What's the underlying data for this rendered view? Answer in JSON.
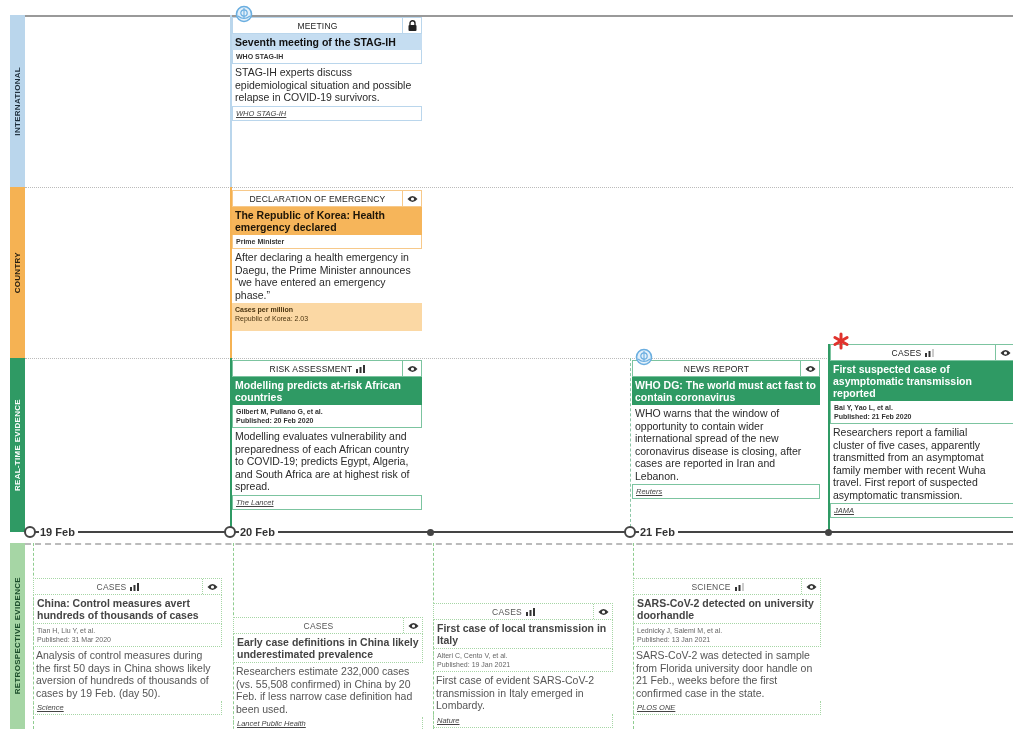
{
  "lanes": [
    {
      "kind": "international",
      "label": "INTERNATIONAL"
    },
    {
      "kind": "country",
      "label": "COUNTRY"
    },
    {
      "kind": "realtime",
      "label": "REAL-TIME EVIDENCE"
    },
    {
      "kind": "retrospective",
      "label": "RETROSPECTIVE EVIDENCE"
    }
  ],
  "columns": [
    {
      "kind": "open",
      "date": "19 Feb",
      "retrospective": [
        {
          "locked": false,
          "category": "CASES",
          "evidence_bars": [
            {
              "filled": true
            },
            {
              "filled": true
            },
            {
              "filled": true
            }
          ],
          "title": "China: Control measures avert hundreds of thousands of cases",
          "authors": "Tian H, Liu Y, et al.",
          "published": "Published: 31 Mar 2020",
          "body": "Analysis of control measures during the first 50 days in China shows likely aversion of hundreds of thousands of cases by 19 Feb. (day 50).",
          "link": "Science"
        }
      ]
    },
    {
      "kind": "open",
      "date": "20 Feb",
      "international": [
        {
          "kind": "who",
          "locked": true,
          "category": "MEETING",
          "title": "Seventh meeting of the STAG-IH",
          "authors": "WHO STAG-IH",
          "body": "STAG-IH experts discuss epidemiological situation and possible relapse in COVID-19 survivors.",
          "link": "WHO STAG-IH"
        }
      ],
      "country": [
        {
          "locked": false,
          "category": "DECLARATION OF EMERGENCY",
          "title": "The Republic of Korea: Health emergency declared",
          "authors": "Prime Minister",
          "body": "After declaring a health emergency in Daegu, the Prime Minister announces “we have entered an emergency phase.”",
          "stats_title": "Cases per million",
          "stats_value": "Republic of Korea: 2.03"
        }
      ],
      "realtime": [
        {
          "locked": false,
          "category": "RISK ASSESSMENT",
          "evidence_bars": [
            {
              "filled": true
            },
            {
              "filled": true
            },
            {
              "filled": true
            }
          ],
          "title": "Modelling predicts at-risk African countries",
          "authors": "Gilbert M, Pullano G, et al.",
          "published": "Published: 20 Feb 2020",
          "body": "Modelling evaluates vulnerability and preparedness of each African country to COVID-19; predicts Egypt, Algeria, and South Africa are at highest risk of spread.",
          "link": "The Lancet"
        }
      ],
      "retrospective": [
        {
          "locked": false,
          "category": "CASES",
          "title": "Early case definitions in China likely underestimated prevalence",
          "body": "Researchers estimate 232,000 cases (vs. 55,508 confirmed) in China by 20 Feb. if less narrow case definition had been used.",
          "link": "Lancet Public Health"
        }
      ]
    },
    {
      "kind": "dot",
      "retrospective": [
        {
          "locked": false,
          "category": "CASES",
          "evidence_bars": [
            {
              "filled": true
            },
            {
              "filled": true
            },
            {
              "filled": true
            }
          ],
          "title": "First case of local transmission in Italy",
          "authors": "Alteri C, Cento V, et al.",
          "published": "Published: 19 Jan 2021",
          "body": "First case of evident SARS-CoV-2 transmission in Italy emerged in Lombardy.",
          "link": "Nature"
        }
      ]
    },
    {
      "kind": "open",
      "date": "21 Feb",
      "realtime": [
        {
          "kind": "who",
          "locked": false,
          "category": "NEWS REPORT",
          "title": "WHO DG: The world must act fast to contain coronavirus",
          "body": "WHO warns that the window of opportunity to contain wider international spread of the new coronavirus disease is closing, after cases are reported in Iran and Lebanon.",
          "link": "Reuters"
        }
      ],
      "retrospective": [
        {
          "locked": false,
          "category": "SCIENCE",
          "evidence_bars": [
            {
              "filled": true
            },
            {
              "filled": true
            },
            {
              "filled": false
            }
          ],
          "title": "SARS-CoV-2 detected on university doorhandle",
          "authors": "Lednicky J, Salemi M, et al.",
          "published": "Published: 13 Jan 2021",
          "body": "SARS-CoV-2 was detected in sample from Florida university door handle on 21 Feb., weeks before the first confirmed case in the state.",
          "link": "PLOS ONE"
        }
      ]
    },
    {
      "kind": "dot",
      "realtime": [
        {
          "kind": "alert",
          "locked": false,
          "category": "CASES",
          "evidence_bars": [
            {
              "filled": true
            },
            {
              "filled": true
            },
            {
              "filled": false
            }
          ],
          "title": "First suspected case of asymptomatic transmission reported",
          "authors": "Bai Y, Yao L, et al.",
          "published": "Published: 21 Feb 2020",
          "body": "Researchers report a familial\ncluster of five cases, apparently\ntransmitted from an asymptomat\nfamily member with recent Wuha\ntravel. First report of suspected\nasymptomatic transmission.",
          "link": "JAMA"
        }
      ]
    }
  ]
}
